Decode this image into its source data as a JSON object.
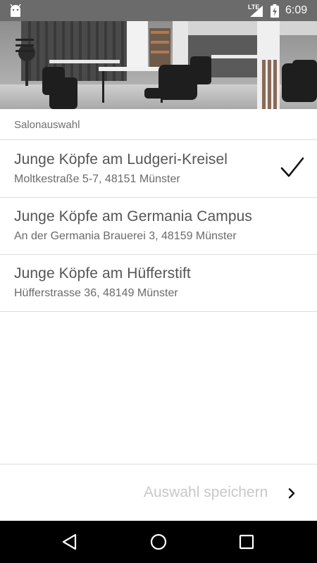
{
  "status_bar": {
    "network_label": "LTE",
    "time": "6:09",
    "icons": [
      "android-icon",
      "signal-icon",
      "battery-charging-icon"
    ]
  },
  "header": {
    "menu_icon": "hamburger-menu-icon"
  },
  "section": {
    "title": "Salonauswahl"
  },
  "salons": [
    {
      "name": "Junge Köpfe am Ludgeri-Kreisel",
      "address": "Moltkestraße 5-7, 48151 Münster",
      "selected": true
    },
    {
      "name": "Junge Köpfe am Germania Campus",
      "address": "An der Germania Brauerei 3, 48159 Münster",
      "selected": false
    },
    {
      "name": "Junge Köpfe am Hüfferstift",
      "address": "Hüfferstrasse 36, 48149 Münster",
      "selected": false
    }
  ],
  "footer": {
    "save_label": "Auswahl speichern",
    "save_icon": "chevron-right-icon"
  },
  "nav_bar": {
    "icons": [
      "back-icon",
      "home-icon",
      "recents-icon"
    ]
  },
  "colors": {
    "status_bar": "#6b6b6b",
    "nav_bar": "#000000",
    "disabled_text": "#c8c8c8",
    "divider": "#dcdcdc"
  }
}
